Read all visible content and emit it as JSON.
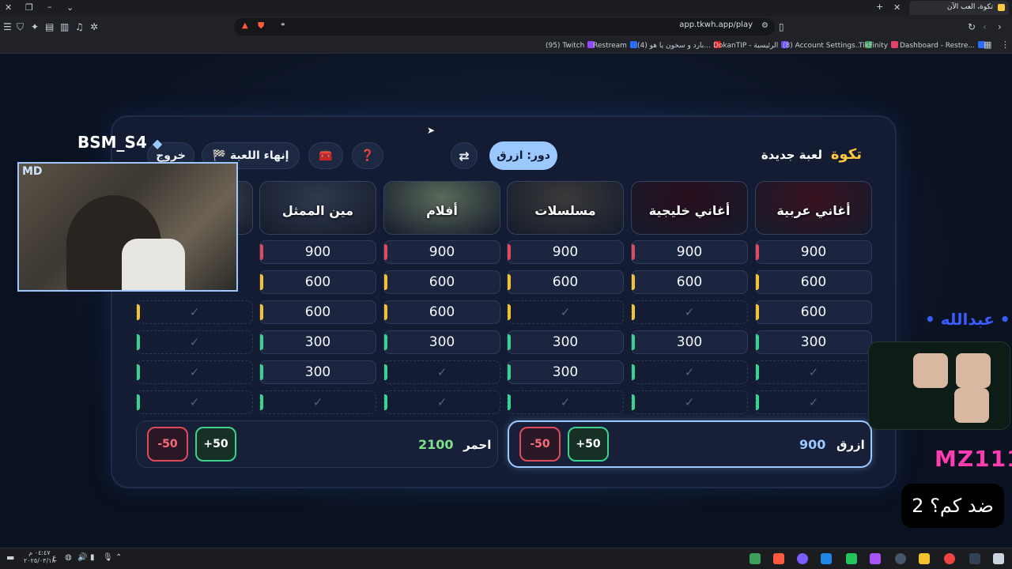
{
  "browser": {
    "tab_title": "تكوة، العب الآن",
    "url": "app.tkwh.app/play",
    "bookmarks": [
      {
        "label": "(95) Twitch",
        "color": "#9146ff"
      },
      {
        "label": "Restream",
        "color": "#2b6cff"
      },
      {
        "label": "(4) بارد و سخون يا هو...",
        "color": "#e02020"
      },
      {
        "label": "DokanTIP - الرئيسية",
        "color": "#6a4cff"
      },
      {
        "label": "(8) Account Settings...",
        "color": "#3aa05a"
      },
      {
        "label": "TikFinity",
        "color": "#e0406a"
      },
      {
        "label": "Dashboard - Restre...",
        "color": "#2b6cff"
      }
    ]
  },
  "game": {
    "brand": "تكوة",
    "new_game": "لعبة جديدة",
    "turn": "دور: ازرق",
    "swap_icon": "⇄",
    "help_icon": "❓",
    "tools_icon": "🧰",
    "end_game": "🏁 إنهاء اللعبة",
    "exit": "خروج",
    "categories": [
      {
        "name": "أغاني عربية",
        "bg": "#3a1220"
      },
      {
        "name": "أغاني خليجية",
        "bg": "#2a0e1c"
      },
      {
        "name": "مسلسلات",
        "bg": "#3a3a3a"
      },
      {
        "name": "أفلام",
        "bg": "#5a6a5a"
      },
      {
        "name": "مين الممثل",
        "bg": "#2f3a4e"
      },
      {
        "name": "",
        "bg": "#4a4a55"
      }
    ],
    "columns": [
      [
        "900",
        "600",
        "600",
        "300",
        "✓",
        "✓"
      ],
      [
        "900",
        "600",
        "✓",
        "300",
        "✓",
        "✓"
      ],
      [
        "900",
        "600",
        "✓",
        "300",
        "300",
        "✓"
      ],
      [
        "900",
        "600",
        "600",
        "300",
        "✓",
        "✓"
      ],
      [
        "900",
        "600",
        "600",
        "300",
        "300",
        "✓"
      ],
      [
        "",
        "",
        "✓",
        "✓",
        "✓",
        "✓"
      ]
    ],
    "row_colors": [
      "#e04a5a",
      "#f2c230",
      "#f2c230",
      "#3ad28e",
      "#3ad28e",
      "#3ad28e"
    ],
    "teams": [
      {
        "name": "ازرق",
        "score": "900",
        "plus": "+50",
        "minus": "-50",
        "accent": "#9ac8ff"
      },
      {
        "name": "احمر",
        "score": "2100",
        "plus": "+50",
        "minus": "-50",
        "accent": "#7ee08a"
      }
    ]
  },
  "overlay": {
    "streamer_tag": "BSM_S4",
    "webcam_logo": "MD",
    "chat_name": "• عبدالله •",
    "mz_tag": "MZ111",
    "question": "2 ضد كم؟"
  },
  "taskbar": {
    "clock_time": "٠٤:٤٧ م",
    "clock_date": "٢٠٢٥/٠٣/١٨"
  }
}
